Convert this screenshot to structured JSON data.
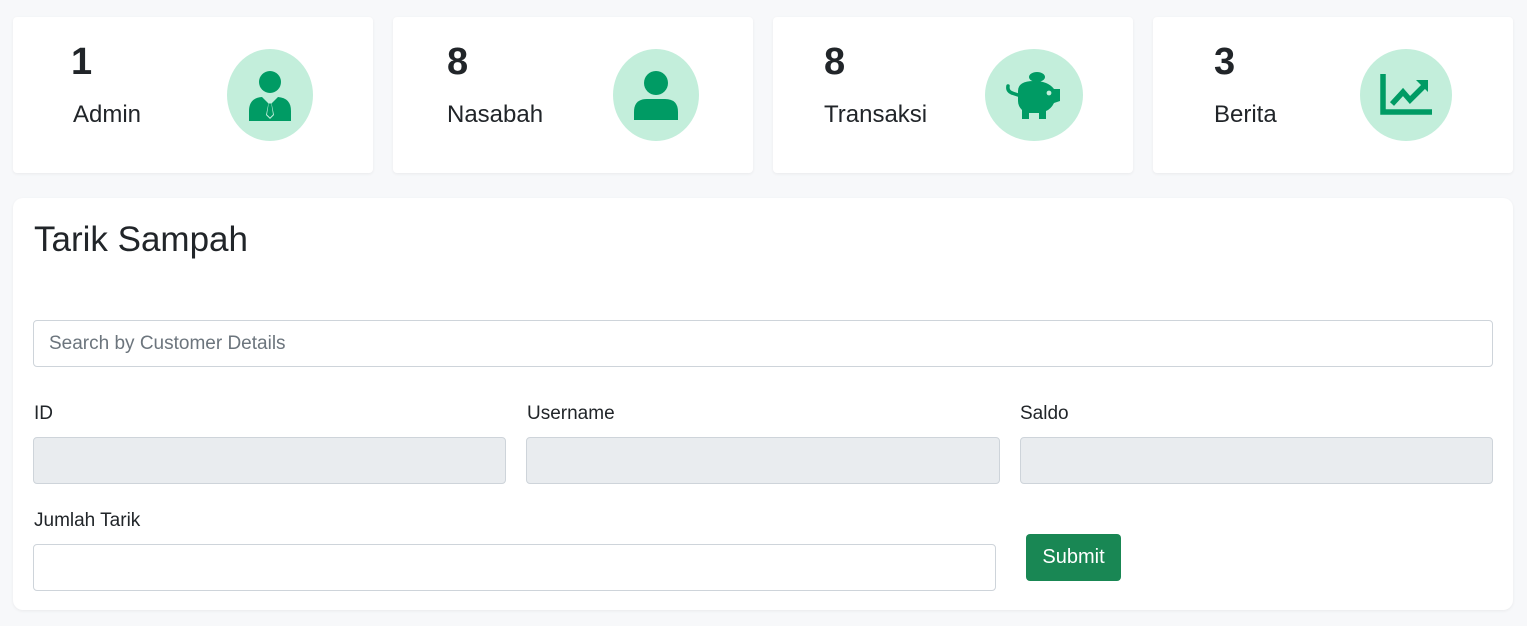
{
  "stats": [
    {
      "count": "1",
      "label": "Admin",
      "icon": "admin-tie-icon"
    },
    {
      "count": "8",
      "label": "Nasabah",
      "icon": "user-icon"
    },
    {
      "count": "8",
      "label": "Transaksi",
      "icon": "piggy-bank-icon"
    },
    {
      "count": "3",
      "label": "Berita",
      "icon": "chart-line-icon"
    }
  ],
  "colors": {
    "icon_bg": "#c3eedb",
    "icon_fg": "#009b64",
    "submit_bg": "#198754",
    "readonly_bg": "#e9ecef"
  },
  "form": {
    "title": "Tarik Sampah",
    "search_placeholder": "Search by Customer Details",
    "search_value": "",
    "id_label": "ID",
    "id_value": "",
    "username_label": "Username",
    "username_value": "",
    "saldo_label": "Saldo",
    "saldo_value": "",
    "jumlah_label": "Jumlah Tarik",
    "jumlah_value": "",
    "submit_label": "Submit"
  }
}
